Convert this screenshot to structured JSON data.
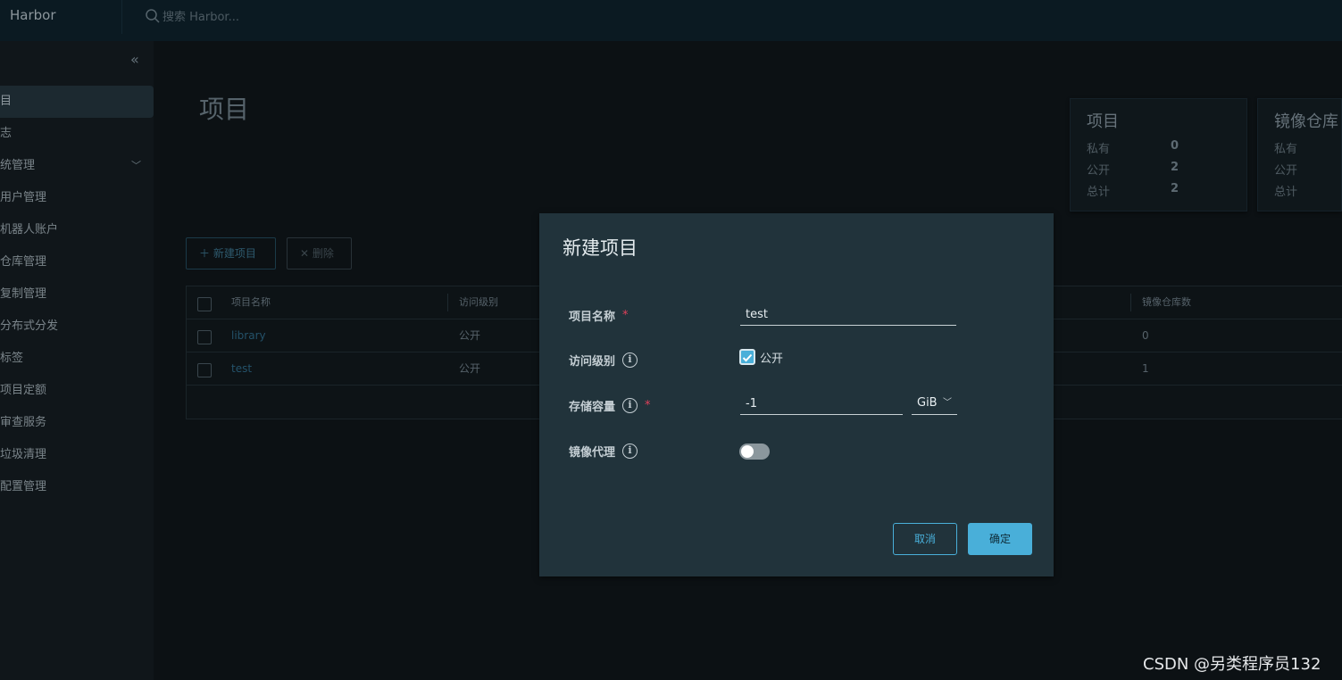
{
  "header": {
    "brand": "Harbor",
    "search_placeholder": "搜索 Harbor..."
  },
  "sidebar": {
    "items": [
      {
        "label": "目",
        "active": true
      },
      {
        "label": "志"
      },
      {
        "label": "统管理",
        "expandable": true
      },
      {
        "label": "用户管理"
      },
      {
        "label": "机器人账户"
      },
      {
        "label": "仓库管理"
      },
      {
        "label": "复制管理"
      },
      {
        "label": "分布式分发"
      },
      {
        "label": "标签"
      },
      {
        "label": "项目定额"
      },
      {
        "label": "审查服务"
      },
      {
        "label": "垃圾清理"
      },
      {
        "label": "配置管理"
      }
    ]
  },
  "main": {
    "title": "项目",
    "stats": [
      {
        "title": "项目",
        "rows": [
          {
            "k": "私有",
            "v": "0"
          },
          {
            "k": "公开",
            "v": "2"
          },
          {
            "k": "总计",
            "v": "2"
          }
        ]
      },
      {
        "title": "镜像仓库",
        "rows": [
          {
            "k": "私有",
            "v": ""
          },
          {
            "k": "公开",
            "v": ""
          },
          {
            "k": "总计",
            "v": ""
          }
        ]
      }
    ],
    "actions": {
      "new": "新建项目",
      "delete": "删除"
    },
    "table": {
      "columns": [
        "项目名称",
        "访问级别",
        "镜像仓库数"
      ],
      "rows": [
        {
          "name": "library",
          "access": "公开",
          "repos": "0"
        },
        {
          "name": "test",
          "access": "公开",
          "repos": "1"
        }
      ]
    }
  },
  "modal": {
    "title": "新建项目",
    "fields": {
      "name_label": "项目名称",
      "name_value": "test",
      "access_label": "访问级别",
      "access_option": "公开",
      "access_checked": true,
      "storage_label": "存储容量",
      "storage_value": "-1",
      "storage_unit": "GiB",
      "proxy_label": "镜像代理",
      "proxy_on": false
    },
    "buttons": {
      "cancel": "取消",
      "ok": "确定"
    }
  },
  "watermark": "CSDN @另类程序员132",
  "colors": {
    "accent": "#49afd9",
    "modal_bg": "#21333b",
    "required": "#e0405a"
  }
}
